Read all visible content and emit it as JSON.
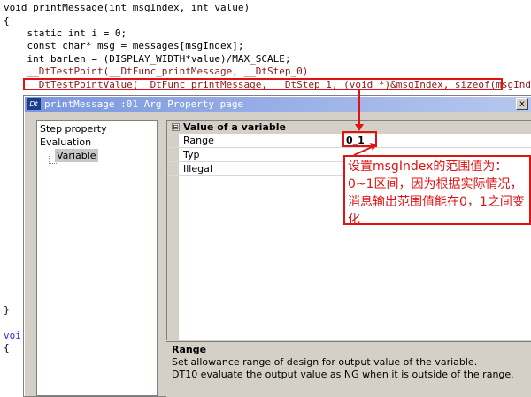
{
  "code": {
    "lines_top": [
      "void printMessage(int msgIndex, int value)",
      "{",
      "    static int i = 0;",
      "    const char* msg = messages[msgIndex];",
      "    int barLen = (DISPLAY_WIDTH*value)/MAX_SCALE;",
      "    __DtTestPoint(__DtFunc_printMessage, __DtStep_0)",
      "    __DtTestPointValue(__DtFunc_printMessage, __DtStep_1, (void *)&msgIndex, sizeof(msgIndex))"
    ],
    "close_brace": "}",
    "next_func_partial": "voi",
    "next_open_brace": "{"
  },
  "dialog": {
    "app_icon": "Dt",
    "title": "printMessage :01 Arg Property page",
    "close_glyph": "x"
  },
  "tree": {
    "items": [
      "Step property",
      "Evaluation",
      "Variable"
    ]
  },
  "grid": {
    "category_expander": "⊟",
    "category_label": "Value of a variable",
    "rows": [
      {
        "label": "Range",
        "value": "0_1"
      },
      {
        "label": "Typ",
        "value": ""
      },
      {
        "label": "Illegal",
        "value": ""
      }
    ]
  },
  "help": {
    "title": "Range",
    "lines": [
      "Set allowance range of design for output value of the variable.",
      "DT10 evaluate the output value as NG when it is outside of the range."
    ]
  },
  "annotation": {
    "text": "设置msgIndex的范围值为：0~1区间，因为根据实际情况，消息输出范围值能在0，1之间变化",
    "color": "#e11212"
  }
}
